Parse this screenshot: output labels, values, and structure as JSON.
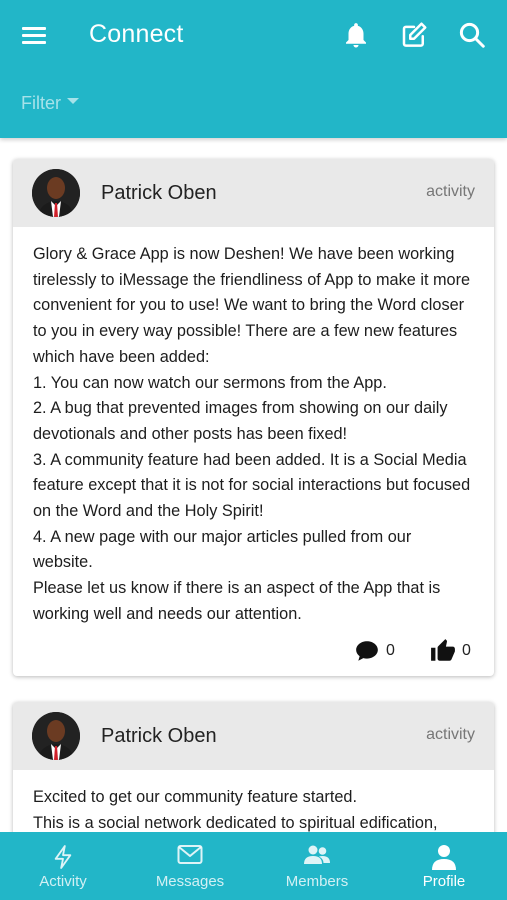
{
  "header": {
    "title": "Connect",
    "filter_label": "Filter"
  },
  "posts": [
    {
      "author": "Patrick Oben",
      "tag": "activity",
      "paragraphs": [
        "Glory & Grace App is now Deshen! We have been working tirelessly to iMessage the friendliness of App to make it more convenient for you to use! We want to bring the Word closer to you in every way possible! There are a few new features which have been added:",
        "1. You can now watch our sermons from the App.",
        "2. A bug that prevented images from showing on our daily devotionals and other posts has been fixed!",
        "3. A community feature had been added. It is a Social Media feature except that it is not for social interactions but focused on the Word and the Holy Spirit!",
        "4. A new page with our major articles pulled from our website.",
        "Please let us know if there is an aspect of the App that is working well and needs our attention."
      ],
      "comments": "0",
      "likes": "0"
    },
    {
      "author": "Patrick Oben",
      "tag": "activity",
      "paragraphs": [
        "Excited to get our community feature started.",
        "This is a social network dedicated to spiritual edification,"
      ]
    }
  ],
  "nav": [
    {
      "label": "Activity",
      "icon": "lightning-icon"
    },
    {
      "label": "Messages",
      "icon": "envelope-icon"
    },
    {
      "label": "Members",
      "icon": "people-icon"
    },
    {
      "label": "Profile",
      "icon": "person-icon",
      "active": true
    }
  ],
  "colors": {
    "brand": "#22b6c8",
    "card_header": "#e9e9e9"
  }
}
